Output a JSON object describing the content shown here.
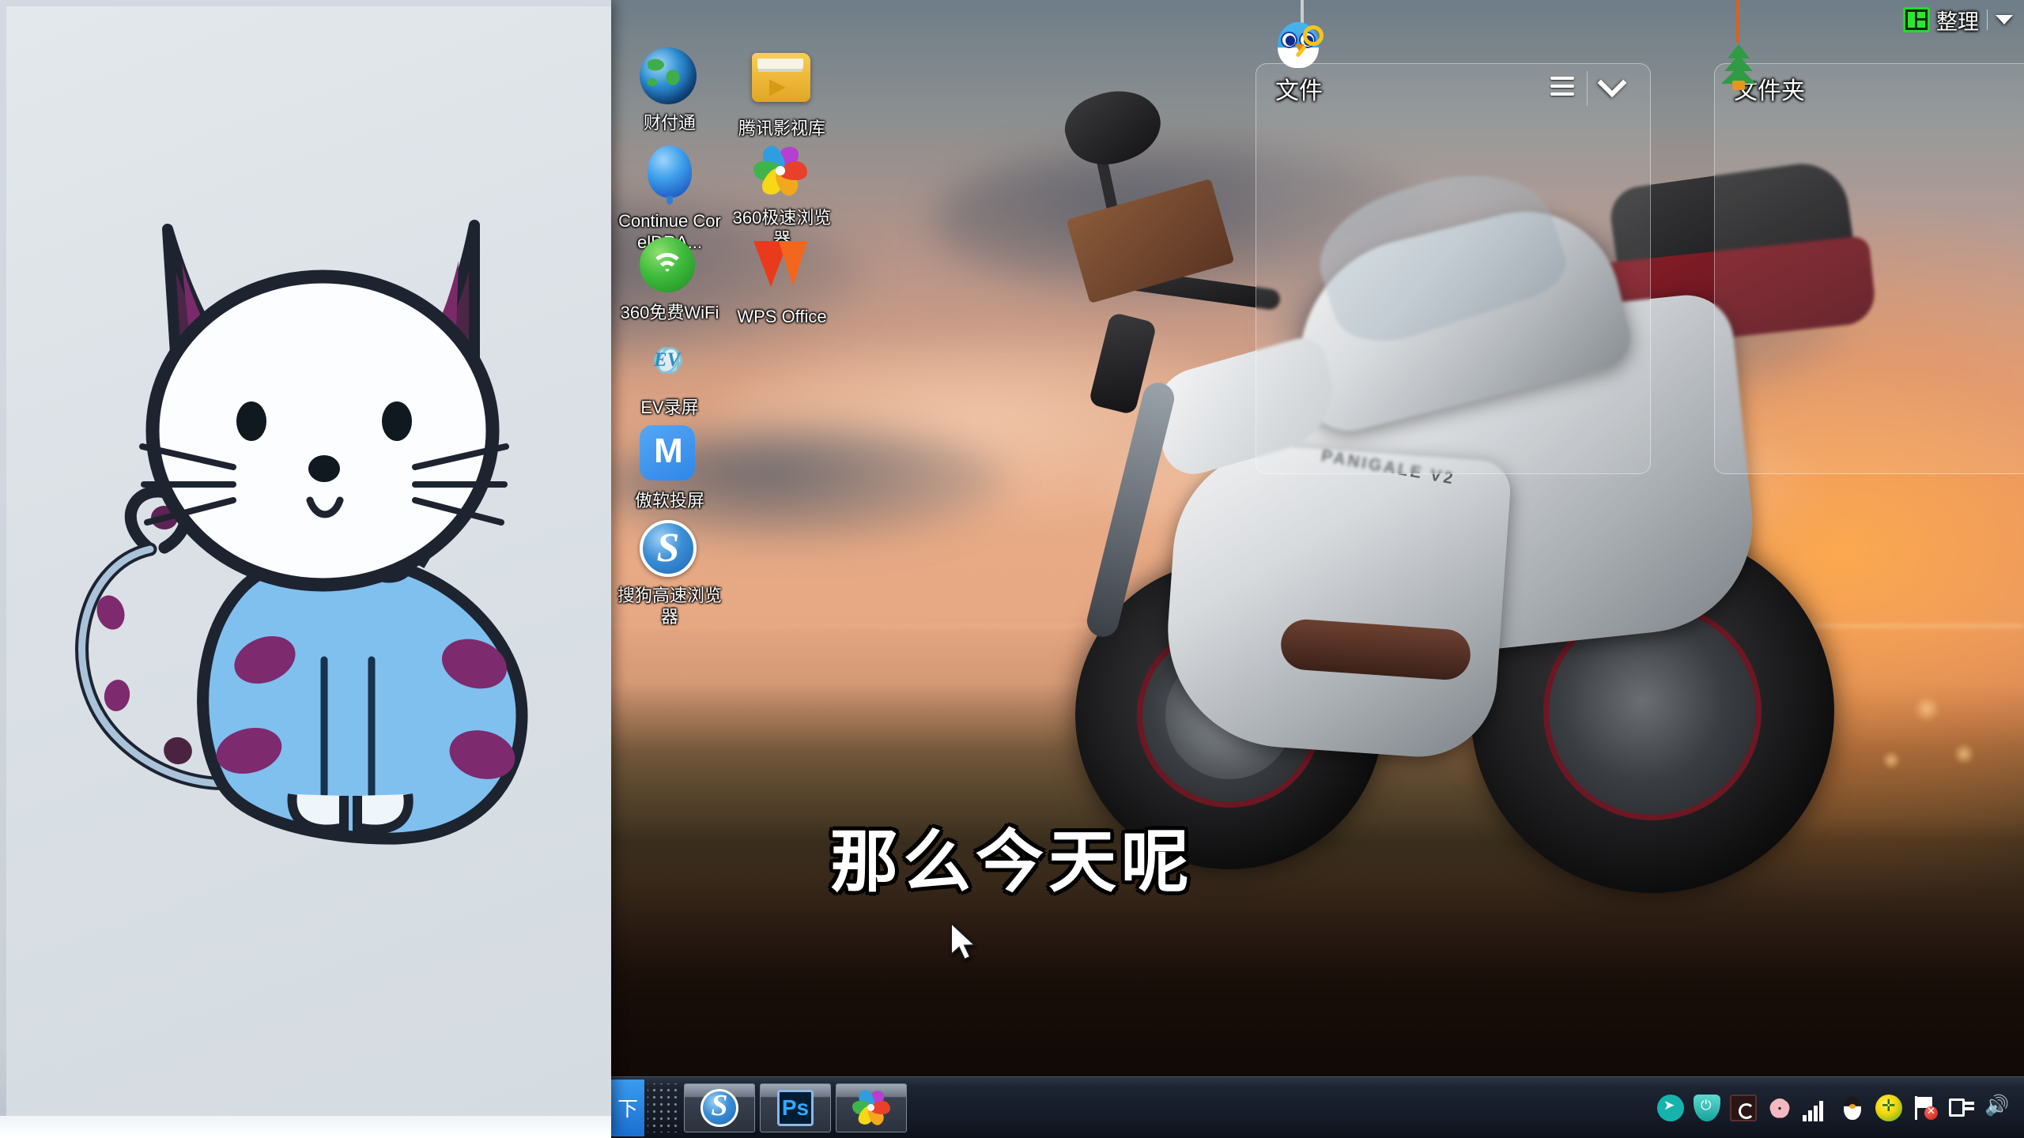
{
  "desktop": {
    "wallpaper_description": "Ducati Panigale V2 motorcycle at sunset",
    "motorcycle_badge": "PANIGALE V2",
    "icons": [
      {
        "label": "财付通",
        "icon": "globe-icon",
        "col": 0,
        "row": 0
      },
      {
        "label": "腾讯影视库",
        "icon": "folder-media-icon",
        "col": 1,
        "row": 0
      },
      {
        "label": "Continue CorelDRA...",
        "icon": "balloon-icon",
        "col": 0,
        "row": 1
      },
      {
        "label": "360极速浏览器",
        "icon": "pinwheel-icon",
        "col": 1,
        "row": 1
      },
      {
        "label": "360免费WiFi",
        "icon": "wifi-icon",
        "col": 0,
        "row": 2
      },
      {
        "label": "WPS Office",
        "icon": "wps-icon",
        "col": 1,
        "row": 2
      },
      {
        "label": "EV录屏",
        "icon": "ev-recorder-icon",
        "col": 0,
        "row": 3
      },
      {
        "label": "傲软投屏",
        "icon": "cast-icon",
        "col": 0,
        "row": 4
      },
      {
        "label": "搜狗高速浏览器",
        "icon": "sogou-icon",
        "col": 0,
        "row": 5
      }
    ]
  },
  "organizer": {
    "tidy_button": {
      "label": "整理",
      "icon": "grid-tidy-icon",
      "accent": "#22dd22"
    },
    "panels": [
      {
        "title": "文件",
        "ornament": "owl-icon",
        "list_icon": "list-view-icon",
        "collapse_icon": "chevron-down-icon"
      },
      {
        "title": "文件夹",
        "ornament": "tree-icon"
      }
    ]
  },
  "subtitle": {
    "text": "那么今天呢"
  },
  "taskbar": {
    "start_glyph": "下",
    "items": [
      {
        "label": "搜狗高速浏览器",
        "icon": "sogou-icon"
      },
      {
        "label": "Photoshop",
        "icon": "photoshop-icon",
        "text": "Ps"
      },
      {
        "label": "360极速浏览器",
        "icon": "pinwheel-icon"
      }
    ],
    "tray": [
      {
        "name": "media-play-icon"
      },
      {
        "name": "security-shield-icon"
      },
      {
        "name": "screen-capture-icon"
      },
      {
        "name": "flower-icon"
      },
      {
        "name": "signal-bars-icon"
      },
      {
        "name": "qq-penguin-icon"
      },
      {
        "name": "yellow-plus-icon"
      },
      {
        "name": "network-flag-error-icon"
      },
      {
        "name": "usb-eject-icon"
      },
      {
        "name": "volume-icon"
      }
    ]
  },
  "left_panel": {
    "description": "hand-drawn cat sketch on white paper",
    "colors": {
      "paper": "#dbe1e6",
      "body": "#7fc0ef",
      "spots": "#7d2a6e",
      "outline": "#1d2430",
      "ear_inner": "#7a2a6a"
    }
  }
}
